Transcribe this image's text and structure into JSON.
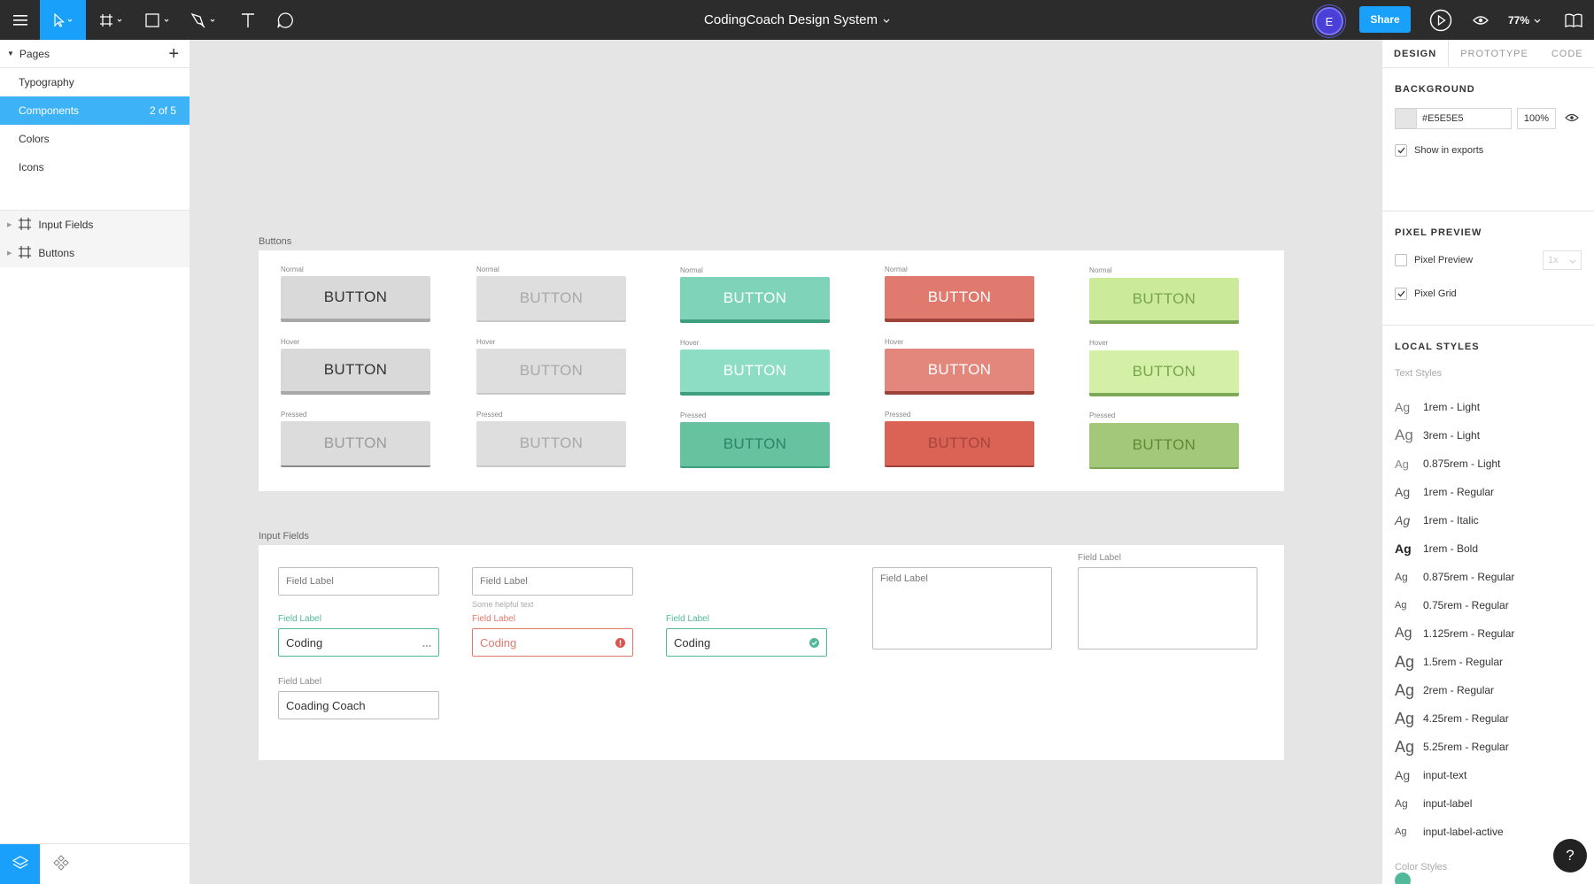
{
  "toolbar": {
    "document_title": "CodingCoach Design System",
    "avatar_initial": "E",
    "share_label": "Share",
    "zoom_level": "77%"
  },
  "left_panel": {
    "pages_header": "Pages",
    "pages": [
      {
        "label": "Typography",
        "count": ""
      },
      {
        "label": "Components",
        "count": "2 of 5"
      },
      {
        "label": "Colors",
        "count": ""
      },
      {
        "label": "Icons",
        "count": ""
      }
    ],
    "layers": [
      {
        "label": "Input Fields"
      },
      {
        "label": "Buttons"
      }
    ]
  },
  "canvas": {
    "buttons_frame_label": "Buttons",
    "button_text": "BUTTON",
    "state_labels": [
      "Normal",
      "Hover",
      "Pressed"
    ],
    "inputs_frame_label": "Input Fields",
    "inputs": {
      "placeholder_1": "Field Label",
      "placeholder_2": "Field Label",
      "helper_text": "Some helpful text",
      "label_active": "Field Label",
      "value_active": "Coding",
      "label_error": "Field Label",
      "value_error": "Coding",
      "label_success": "Field Label",
      "value_success": "Coding",
      "label_filled": "Field Label",
      "value_filled": "Coading Coach",
      "textarea_placeholder": "Field Label",
      "textarea_label": "Field Label"
    }
  },
  "right_panel": {
    "tabs": [
      "DESIGN",
      "PROTOTYPE",
      "CODE"
    ],
    "background": {
      "title": "BACKGROUND",
      "hex": "#E5E5E5",
      "opacity": "100%",
      "show_in_exports": "Show in exports"
    },
    "pixel_preview": {
      "title": "PIXEL PREVIEW",
      "pixel_preview_label": "Pixel Preview",
      "scale": "1x",
      "pixel_grid_label": "Pixel Grid"
    },
    "local_styles": {
      "title": "LOCAL STYLES",
      "text_styles_label": "Text Styles",
      "styles": [
        {
          "name": "1rem - Light"
        },
        {
          "name": "3rem - Light"
        },
        {
          "name": "0.875rem - Light"
        },
        {
          "name": "1rem - Regular"
        },
        {
          "name": "1rem - Italic"
        },
        {
          "name": "1rem - Bold"
        },
        {
          "name": "0.875rem - Regular"
        },
        {
          "name": "0.75rem - Regular"
        },
        {
          "name": "1.125rem - Regular"
        },
        {
          "name": "1.5rem - Regular"
        },
        {
          "name": "2rem - Regular"
        },
        {
          "name": "4.25rem - Regular"
        },
        {
          "name": "5.25rem - Regular"
        },
        {
          "name": "input-text"
        },
        {
          "name": "input-label"
        },
        {
          "name": "input-label-active"
        }
      ],
      "ag_sample": "Ag",
      "color_styles_label": "Color Styles"
    },
    "help_label": "?"
  },
  "colors": {
    "accent": "#18A0FB",
    "toolbar_bg": "#2C2C2C",
    "canvas_bg": "#E5E5E5",
    "teal": "#7ED3B8",
    "red": "#E07A6E",
    "lime": "#CBEB9A"
  },
  "icons": [
    "menu-icon",
    "move-icon",
    "frame-icon",
    "rectangle-icon",
    "pen-icon",
    "text-icon",
    "comment-icon",
    "play-icon",
    "eye-icon",
    "book-icon",
    "layers-icon",
    "components-icon"
  ]
}
